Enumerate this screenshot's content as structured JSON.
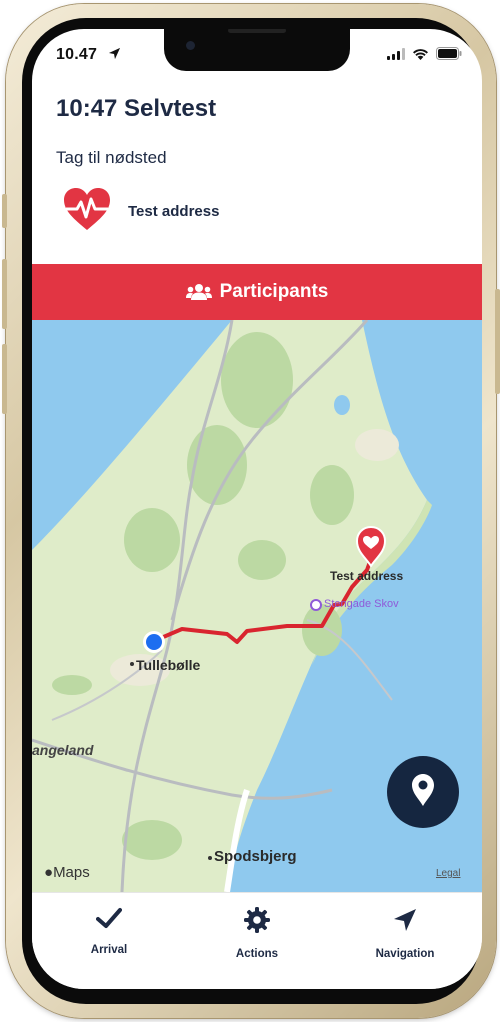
{
  "status_bar": {
    "time": "10.47",
    "icons": [
      "location-arrow-icon",
      "signal-icon",
      "wifi-icon",
      "battery-icon"
    ]
  },
  "header": {
    "title": "10:47 Selvtest",
    "subtitle": "Tag til nødsted",
    "destination": "Test address",
    "destination_icon": "heart-pulse-icon"
  },
  "participants_button": {
    "label": "Participants",
    "icon": "users-icon",
    "color": "#e23543"
  },
  "map": {
    "destination_label": "Test address",
    "poi_label": "Stengade Skov",
    "town_labels": [
      "Tullebølle",
      "Spodsbjerg"
    ],
    "region_label": "angeland",
    "attribution": "Maps",
    "legal_label": "Legal",
    "route_color": "#d9252f",
    "water_color": "#8fc9ee",
    "land_color": "#dfecc9"
  },
  "tabs": [
    {
      "label": "Arrival",
      "icon": "checkmark-icon"
    },
    {
      "label": "Actions",
      "icon": "gear-icon"
    },
    {
      "label": "Navigation",
      "icon": "navigation-arrow-icon"
    }
  ],
  "colors": {
    "primary_text": "#1e2a44",
    "fab": "#152640",
    "user_location": "#1d6ef0"
  }
}
